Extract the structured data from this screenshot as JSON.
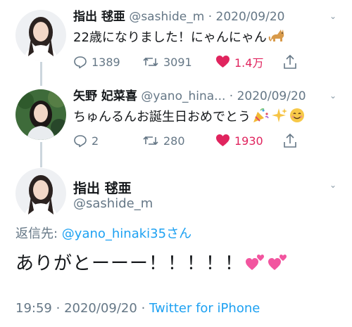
{
  "tweet1": {
    "name": "指出 毬亜",
    "handle": "@sashide_m",
    "separator": "·",
    "date": "2020/09/20",
    "text": "22歳になりました！にゃんにゃん",
    "emoji": "cat-icon",
    "actions": {
      "replies": "1389",
      "retweets": "3091",
      "likes": "1.4万"
    }
  },
  "tweet2": {
    "name": "矢野 妃菜喜",
    "handle": "@yano_hina...",
    "separator": "·",
    "date": "2020/09/20",
    "text": "ちゅんるんお誕生日おめでとう",
    "emojis": [
      "party-popper-icon",
      "sparkles-icon",
      "smiling-face-icon"
    ],
    "actions": {
      "replies": "2",
      "retweets": "280",
      "likes": "1930"
    }
  },
  "main": {
    "name": "指出 毬亜",
    "handle": "@sashide_m",
    "reply_prefix": "返信先: ",
    "reply_to": "@yano_hinaki35さん",
    "text": "ありがとーーー！！！！！",
    "emojis": [
      "two-hearts-icon",
      "two-hearts-icon"
    ],
    "time": "19:59",
    "date": "2020/09/20",
    "separator": "·",
    "source": "Twitter for iPhone"
  },
  "colors": {
    "link": "#1da1f2",
    "like": "#e0245e",
    "secondary": "#657786",
    "thread_line": "#ccd6dd"
  }
}
